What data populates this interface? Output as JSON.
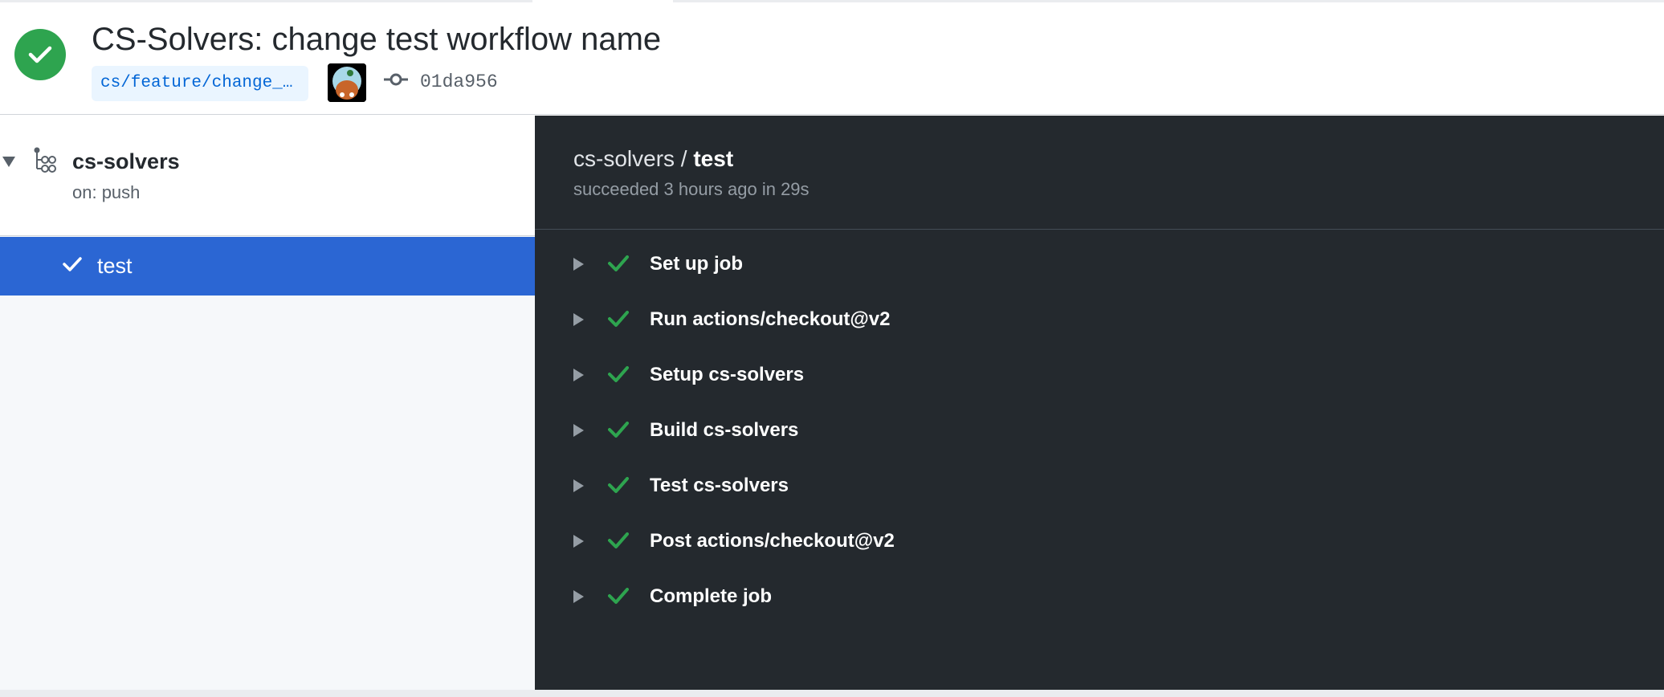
{
  "header": {
    "title": "CS-Solvers: change test workflow name",
    "branch": "cs/feature/change_…",
    "commit_sha": "01da956",
    "status_color": "#2ea44f"
  },
  "sidebar": {
    "workflow": {
      "name": "cs-solvers",
      "trigger": "on: push"
    },
    "jobs": [
      {
        "label": "test",
        "status": "success"
      }
    ],
    "selected_color": "#2b66d3"
  },
  "panel": {
    "breadcrumb_workflow": "cs-solvers",
    "breadcrumb_sep": " / ",
    "breadcrumb_job": "test",
    "summary": "succeeded 3 hours ago in 29s",
    "steps": [
      {
        "label": "Set up job"
      },
      {
        "label": "Run actions/checkout@v2"
      },
      {
        "label": "Setup cs-solvers"
      },
      {
        "label": "Build cs-solvers"
      },
      {
        "label": "Test cs-solvers"
      },
      {
        "label": "Post actions/checkout@v2"
      },
      {
        "label": "Complete job"
      }
    ],
    "background": "#24292e",
    "check_color": "#2ea44f"
  },
  "icons": {
    "status": "check-circle-icon",
    "commit": "git-commit-icon",
    "workflow": "workflow-icon",
    "expand": "triangle-right-icon",
    "collapse": "triangle-down-icon"
  }
}
